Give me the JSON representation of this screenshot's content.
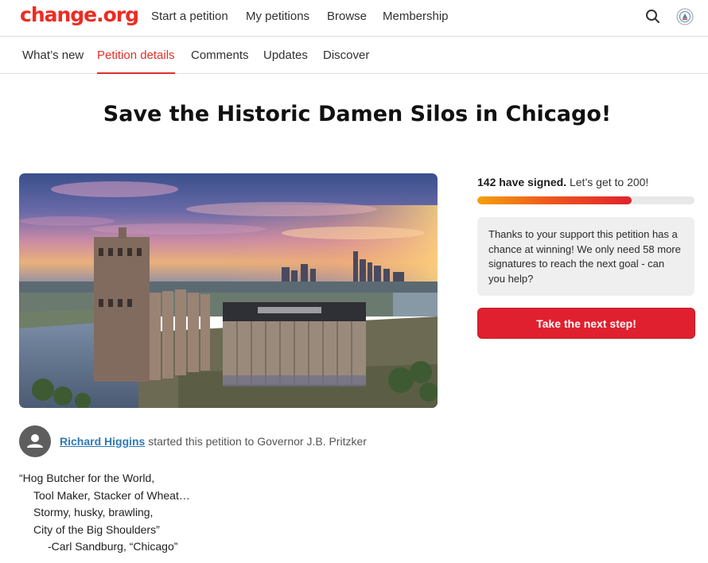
{
  "brand": {
    "logo_text": "change.org",
    "color": "#ec2c22"
  },
  "nav": {
    "items": [
      {
        "label": "Start a petition"
      },
      {
        "label": "My petitions"
      },
      {
        "label": "Browse"
      },
      {
        "label": "Membership"
      }
    ],
    "search_icon": "search-icon",
    "avatar_icon": "user-avatar-icon"
  },
  "tabs": [
    {
      "label": "What’s new",
      "active": false
    },
    {
      "label": "Petition details",
      "active": true
    },
    {
      "label": "Comments",
      "active": false
    },
    {
      "label": "Updates",
      "active": false
    },
    {
      "label": "Discover",
      "active": false
    }
  ],
  "petition": {
    "title": "Save the Historic Damen Silos in Chicago!",
    "image": "aerial-photo-damen-silos-chicago-skyline-sunset",
    "author_name": "Richard Higgins",
    "author_suffix": " started this petition to Governor J.B. Pritzker",
    "quote": [
      "“Hog Butcher for the World,",
      "Tool Maker, Stacker of Wheat…",
      "Stormy, husky, brawling,",
      "City of the Big Shoulders”",
      "-Carl Sandburg, “Chicago”"
    ]
  },
  "signatures": {
    "count_text": "142 have signed.",
    "goal_text": " Let’s get to 200!",
    "signed": 142,
    "goal": 200,
    "progress_fraction": 0.71
  },
  "callout": {
    "text": "Thanks to your support this petition has a chance at winning! We only need 58 more signatures to reach the next goal - can you help?"
  },
  "cta": {
    "label": "Take the next step!",
    "color": "#e0202e"
  }
}
